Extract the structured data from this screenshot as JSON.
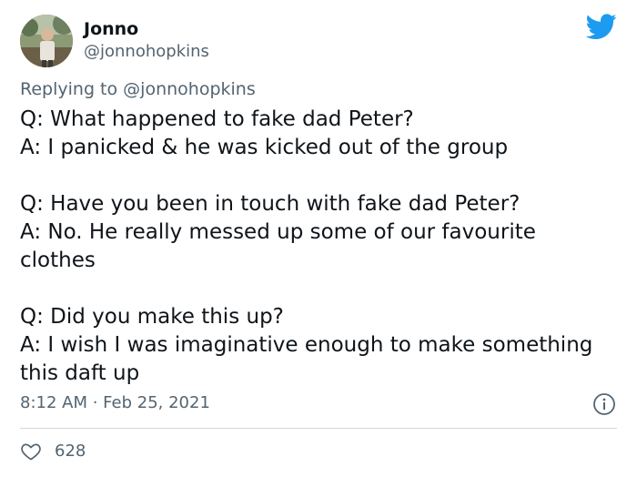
{
  "author": {
    "display_name": "Jonno",
    "handle": "@jonnohopkins",
    "avatar_icon": "profile-photo"
  },
  "brand": {
    "icon": "twitter-bird-icon",
    "color": "#1d9bf0"
  },
  "replying": {
    "prefix": "Replying to",
    "mention": "@jonnohopkins"
  },
  "tweet": {
    "lines": [
      "Q: What happened to fake dad Peter?",
      "A: I panicked & he was kicked out of the group",
      "",
      "Q: Have you been in touch with fake dad Peter?",
      "A: No. He really messed up some of our favourite clothes",
      "",
      "Q: Did you make this up?",
      "A: I wish I was imaginative enough to make something this daft up"
    ]
  },
  "meta": {
    "timestamp": "8:12 AM · Feb 25, 2021",
    "info_icon": "info-icon"
  },
  "stats": {
    "likes": "628",
    "like_icon": "heart-icon"
  }
}
